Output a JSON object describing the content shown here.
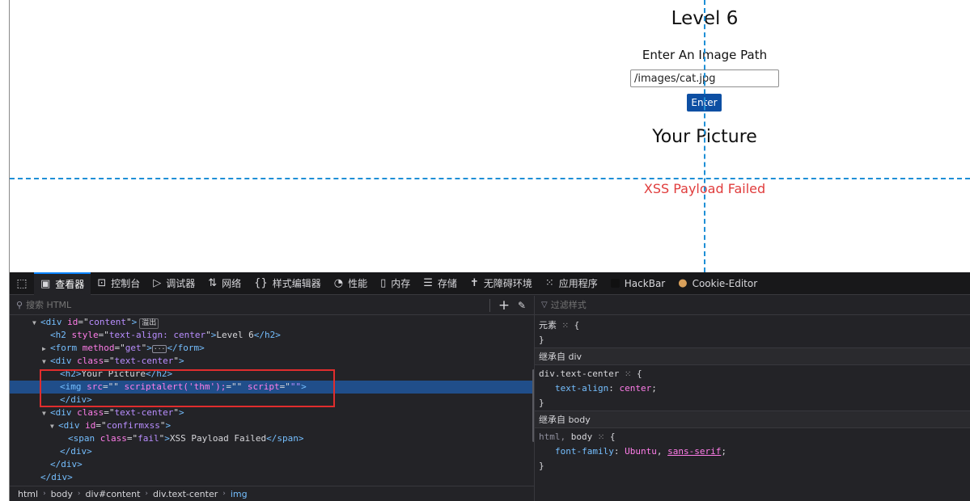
{
  "page": {
    "title": "Level 6",
    "form_label": "Enter An Image Path",
    "input_value": "/images/cat.jpg",
    "enter_label": "Enter",
    "picture_heading": "Your Picture",
    "fail_text": "XSS Payload Failed"
  },
  "devtools": {
    "tabs": [
      {
        "icon": "inspector-icon",
        "label": "查看器",
        "active": true
      },
      {
        "icon": "console-icon",
        "label": "控制台"
      },
      {
        "icon": "debugger-icon",
        "label": "调试器"
      },
      {
        "icon": "network-icon",
        "label": "网络"
      },
      {
        "icon": "style-editor-icon",
        "label": "样式编辑器"
      },
      {
        "icon": "performance-icon",
        "label": "性能"
      },
      {
        "icon": "memory-icon",
        "label": "内存"
      },
      {
        "icon": "storage-icon",
        "label": "存储"
      },
      {
        "icon": "accessibility-icon",
        "label": "无障碍环境"
      },
      {
        "icon": "application-icon",
        "label": "应用程序"
      },
      {
        "icon": "hackbar-icon",
        "label": "HackBar"
      },
      {
        "icon": "cookie-icon",
        "label": "Cookie-Editor"
      }
    ],
    "search_placeholder": "搜索 HTML",
    "markup": {
      "l1": {
        "tag": "div",
        "attr": "id",
        "val": "content",
        "badge": "溢出"
      },
      "l2": {
        "tag": "h2",
        "attr": "style",
        "val": "text-align: center",
        "text": "Level 6"
      },
      "l3": {
        "tag": "form",
        "attr": "method",
        "val": "get"
      },
      "l4": {
        "tag": "div",
        "attr": "class",
        "val": "text-center"
      },
      "l5": {
        "tag": "h2",
        "text": "Your Picture"
      },
      "l6": {
        "tag": "img",
        "attr": "src",
        "val": "",
        "rest1": "scriptalert('thm');",
        "rest2": "script",
        "rest3": "\"\""
      },
      "l7": {
        "tag": "div"
      },
      "l8": {
        "tag": "div",
        "attr": "class",
        "val": "text-center"
      },
      "l9": {
        "tag": "div",
        "attr": "id",
        "val": "confirmxss"
      },
      "l10": {
        "tag": "span",
        "attr": "class",
        "val": "fail",
        "text": "XSS Payload Failed"
      },
      "l11": {
        "tag": "div"
      },
      "l12": {
        "tag": "div"
      },
      "l13": {
        "tag": "div"
      }
    },
    "breadcrumbs": [
      "html",
      "body",
      "div#content",
      "div.text-center",
      "img"
    ],
    "rules": {
      "filter_placeholder": "过滤样式",
      "element_selector": "元素",
      "inherited_div": "继承自 div",
      "div_selector": "div.text-center",
      "div_prop": "text-align",
      "div_val": "center",
      "inherited_body": "继承自 body",
      "body_selector_a": "html,",
      "body_selector_b": "body",
      "body_prop": "font-family",
      "body_val1": "Ubuntu",
      "body_val2": "sans-serif"
    }
  },
  "colors": {
    "accent": "#0a84ff",
    "guide": "#1e8fd6",
    "fail": "#e03c3c",
    "button": "#0d4fa3",
    "highlight": "#e02d2d"
  }
}
